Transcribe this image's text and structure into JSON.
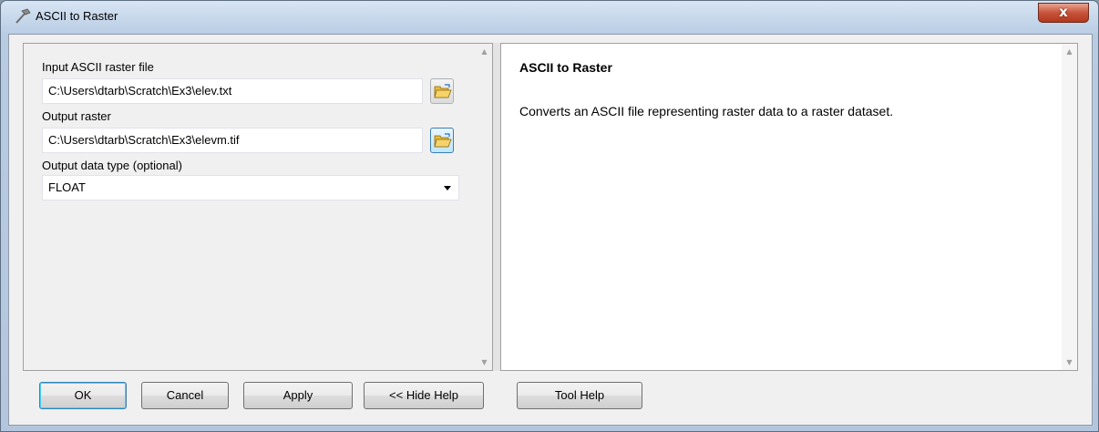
{
  "window": {
    "title": "ASCII to Raster",
    "close_label": "x"
  },
  "form": {
    "input_label": "Input ASCII raster file",
    "input_value": "C:\\Users\\dtarb\\Scratch\\Ex3\\elev.txt",
    "output_label": "Output raster",
    "output_value": "C:\\Users\\dtarb\\Scratch\\Ex3\\elevm.tif",
    "datatype_label": "Output data type (optional)",
    "datatype_value": "FLOAT"
  },
  "help": {
    "title": "ASCII to Raster",
    "body": "Converts an ASCII file representing raster data to a raster dataset."
  },
  "buttons": {
    "ok": "OK",
    "cancel": "Cancel",
    "apply": "Apply",
    "hide_help": "<< Hide Help",
    "tool_help": "Tool Help"
  }
}
